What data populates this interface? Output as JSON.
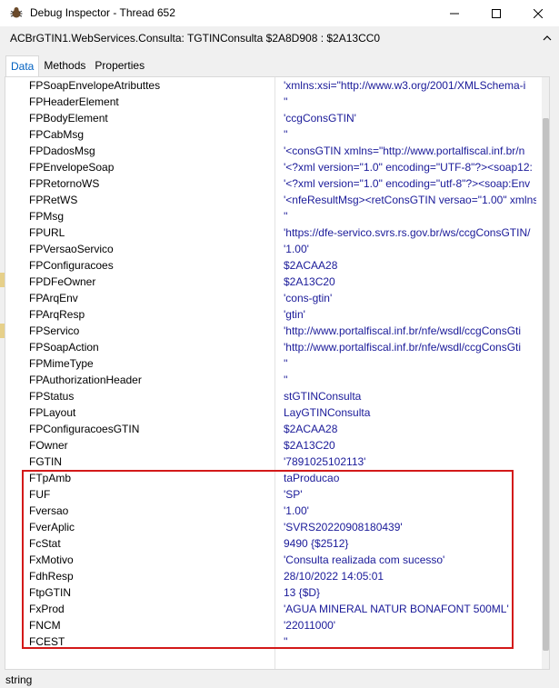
{
  "window": {
    "title": "Debug Inspector - Thread 652",
    "subtitle": "ACBrGTIN1.WebServices.Consulta: TGTINConsulta $2A8D908 : $2A13CC0"
  },
  "tabs": [
    "Data",
    "Methods",
    "Properties"
  ],
  "rows": [
    {
      "name": "FPSoapEnvelopeAtributtes",
      "value": "'xmlns:xsi=\"http://www.w3.org/2001/XMLSchema-i"
    },
    {
      "name": "FPHeaderElement",
      "value": "''"
    },
    {
      "name": "FPBodyElement",
      "value": "'ccgConsGTIN'"
    },
    {
      "name": "FPCabMsg",
      "value": "''"
    },
    {
      "name": "FPDadosMsg",
      "value": "'<consGTIN xmlns=\"http://www.portalfiscal.inf.br/n"
    },
    {
      "name": "FPEnvelopeSoap",
      "value": "'<?xml version=\"1.0\" encoding=\"UTF-8\"?><soap12:"
    },
    {
      "name": "FPRetornoWS",
      "value": "'<?xml version=\"1.0\" encoding=\"utf-8\"?><soap:Env"
    },
    {
      "name": "FPRetWS",
      "value": "'<nfeResultMsg><retConsGTIN versao=\"1.00\" xmlns"
    },
    {
      "name": "FPMsg",
      "value": "''"
    },
    {
      "name": "FPURL",
      "value": "'https://dfe-servico.svrs.rs.gov.br/ws/ccgConsGTIN/"
    },
    {
      "name": "FPVersaoServico",
      "value": "'1.00'"
    },
    {
      "name": "FPConfiguracoes",
      "value": "$2ACAA28"
    },
    {
      "name": "FPDFeOwner",
      "value": "$2A13C20"
    },
    {
      "name": "FPArqEnv",
      "value": "'cons-gtin'"
    },
    {
      "name": "FPArqResp",
      "value": "'gtin'"
    },
    {
      "name": "FPServico",
      "value": "'http://www.portalfiscal.inf.br/nfe/wsdl/ccgConsGti"
    },
    {
      "name": "FPSoapAction",
      "value": "'http://www.portalfiscal.inf.br/nfe/wsdl/ccgConsGti"
    },
    {
      "name": "FPMimeType",
      "value": "''"
    },
    {
      "name": "FPAuthorizationHeader",
      "value": "''"
    },
    {
      "name": "FPStatus",
      "value": "stGTINConsulta"
    },
    {
      "name": "FPLayout",
      "value": "LayGTINConsulta"
    },
    {
      "name": "FPConfiguracoesGTIN",
      "value": "$2ACAA28"
    },
    {
      "name": "FOwner",
      "value": "$2A13C20"
    },
    {
      "name": "FGTIN",
      "value": "'7891025102113'"
    },
    {
      "name": "FTpAmb",
      "value": "taProducao"
    },
    {
      "name": "FUF",
      "value": "'SP'"
    },
    {
      "name": "Fversao",
      "value": "'1.00'"
    },
    {
      "name": "FverAplic",
      "value": "'SVRS20220908180439'"
    },
    {
      "name": "FcStat",
      "value": "9490 {$2512}"
    },
    {
      "name": "FxMotivo",
      "value": "'Consulta realizada com sucesso'"
    },
    {
      "name": "FdhResp",
      "value": "28/10/2022 14:05:01"
    },
    {
      "name": "FtpGTIN",
      "value": "13 {$D}"
    },
    {
      "name": "FxProd",
      "value": "'AGUA MINERAL NATUR BONAFONT 500ML'"
    },
    {
      "name": "FNCM",
      "value": "'22011000'"
    },
    {
      "name": "FCEST",
      "value": "''"
    }
  ],
  "status": "string",
  "colors": {
    "highlight_box": "#d31919",
    "active_tab": "#0060c0"
  }
}
